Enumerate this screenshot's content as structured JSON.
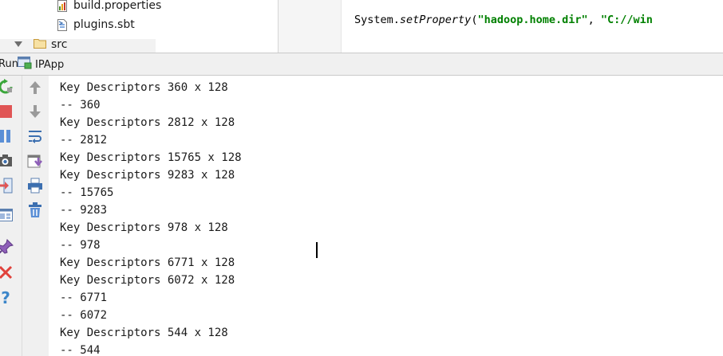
{
  "project_tree": {
    "items": [
      {
        "label": "build.properties",
        "icon": "properties-file-icon"
      },
      {
        "label": "plugins.sbt",
        "icon": "sbt-file-icon"
      },
      {
        "label": "src",
        "icon": "folder-icon",
        "expanded": true
      }
    ]
  },
  "editor": {
    "code_parts": [
      "System.",
      "setProperty",
      "(",
      "\"hadoop.home.dir\"",
      ", ",
      "\"C://win"
    ]
  },
  "run_panel": {
    "title": "Run",
    "tab_label": "IPApp",
    "console_lines": [
      "Key Descriptors 360 x 128",
      "-- 360",
      "Key Descriptors 2812 x 128",
      "-- 2812",
      "Key Descriptors 15765 x 128",
      "Key Descriptors 9283 x 128",
      "-- 15765",
      "-- 9283",
      "Key Descriptors 978 x 128",
      "-- 978",
      "Key Descriptors 6771 x 128",
      "Key Descriptors 6072 x 128",
      "-- 6771",
      "-- 6072",
      "Key Descriptors 544 x 128",
      "-- 544"
    ]
  },
  "toolbar_outer": [
    "rerun-icon",
    "stop-icon",
    "pause-icon",
    "camera-icon",
    "exit-icon",
    "layout-icon",
    "pin-icon",
    "close-icon",
    "help-icon"
  ],
  "toolbar_inner": [
    "up-arrow-icon",
    "down-arrow-icon",
    "soft-wrap-icon",
    "scroll-to-end-icon",
    "print-icon",
    "trash-icon"
  ],
  "colors": {
    "string_literal": "#008000",
    "toolbar_bg": "#f0f0f0",
    "stop_red": "#e05555",
    "rerun_green": "#3aa63a",
    "pause_blue": "#5b8fd6"
  }
}
